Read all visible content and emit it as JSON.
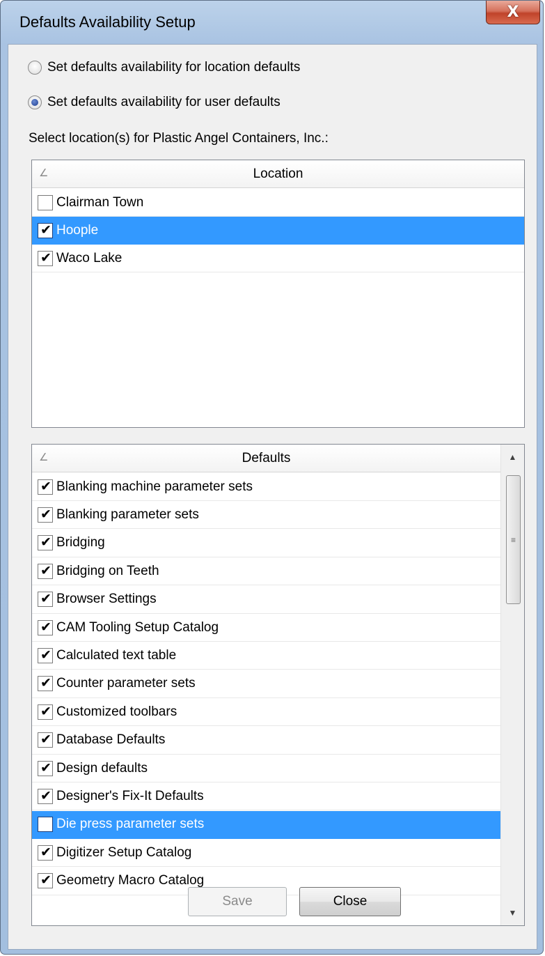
{
  "window": {
    "title": "Defaults Availability Setup",
    "close_glyph": "X"
  },
  "options": {
    "location_defaults_label": "Set defaults availability for location defaults",
    "user_defaults_label": "Set defaults availability for user defaults",
    "selected": "user_defaults"
  },
  "select_prompt": "Select location(s)  for Plastic Angel Containers, Inc.:",
  "location_grid": {
    "header": "Location",
    "rows": [
      {
        "label": "Clairman Town",
        "checked": false,
        "selected": false
      },
      {
        "label": "Hoople",
        "checked": true,
        "selected": true
      },
      {
        "label": "Waco Lake",
        "checked": true,
        "selected": false
      }
    ]
  },
  "defaults_grid": {
    "header": "Defaults",
    "rows": [
      {
        "label": "Blanking machine parameter sets",
        "checked": true,
        "selected": false
      },
      {
        "label": "Blanking parameter sets",
        "checked": true,
        "selected": false
      },
      {
        "label": "Bridging",
        "checked": true,
        "selected": false
      },
      {
        "label": "Bridging on Teeth",
        "checked": true,
        "selected": false
      },
      {
        "label": "Browser Settings",
        "checked": true,
        "selected": false
      },
      {
        "label": "CAM Tooling Setup Catalog",
        "checked": true,
        "selected": false
      },
      {
        "label": "Calculated text table",
        "checked": true,
        "selected": false
      },
      {
        "label": "Counter parameter sets",
        "checked": true,
        "selected": false
      },
      {
        "label": "Customized toolbars",
        "checked": true,
        "selected": false
      },
      {
        "label": "Database Defaults",
        "checked": true,
        "selected": false
      },
      {
        "label": "Design defaults",
        "checked": true,
        "selected": false
      },
      {
        "label": "Designer's Fix-It Defaults",
        "checked": true,
        "selected": false
      },
      {
        "label": "Die press parameter sets",
        "checked": false,
        "selected": true
      },
      {
        "label": "Digitizer Setup Catalog",
        "checked": true,
        "selected": false
      },
      {
        "label": "Geometry Macro Catalog",
        "checked": true,
        "selected": false
      }
    ]
  },
  "buttons": {
    "save_label": "Save",
    "save_enabled": false,
    "close_label": "Close"
  },
  "icons": {
    "sort": "sort-indicator-icon",
    "check": "checkmark-icon",
    "scroll_up": "scroll-up-arrow-icon",
    "scroll_down": "scroll-down-arrow-icon",
    "grip": "scrollbar-grip-icon"
  },
  "colors": {
    "selection": "#3399ff",
    "close_button": "#c0432a",
    "frame": "#a9c3e2"
  }
}
